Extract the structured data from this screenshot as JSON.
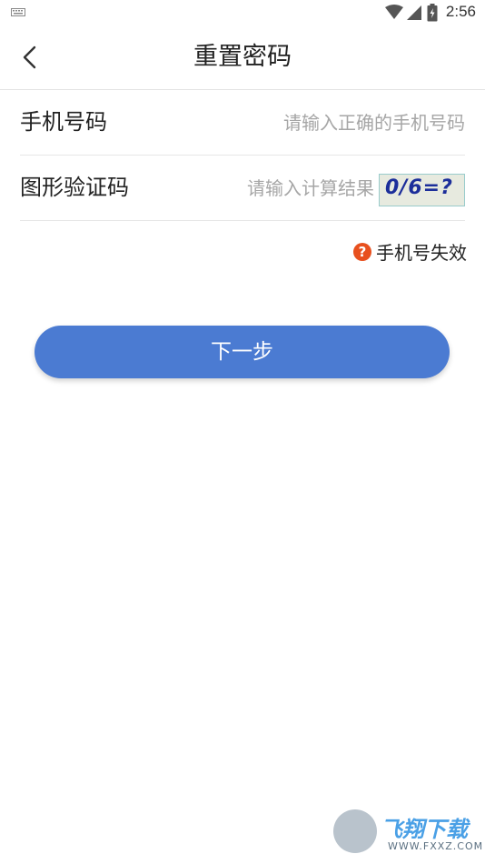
{
  "status_bar": {
    "time": "2:56",
    "icons": [
      "keyboard-icon",
      "wifi-icon",
      "signal-icon",
      "battery-icon"
    ]
  },
  "header": {
    "title": "重置密码",
    "back_icon": "chevron-left-icon"
  },
  "form": {
    "phone": {
      "label": "手机号码",
      "placeholder": "请输入正确的手机号码",
      "value": ""
    },
    "captcha": {
      "label": "图形验证码",
      "placeholder": "请输入计算结果",
      "value": "",
      "image_text": "0/6=?"
    }
  },
  "error": {
    "icon": "question-circle-icon",
    "text": "手机号失效",
    "color": "#e8501e"
  },
  "next_button": {
    "label": "下一步",
    "color": "#4b7bd2"
  },
  "watermark": {
    "brand": "飞翔下载",
    "url": "WWW.FXXZ.COM"
  }
}
